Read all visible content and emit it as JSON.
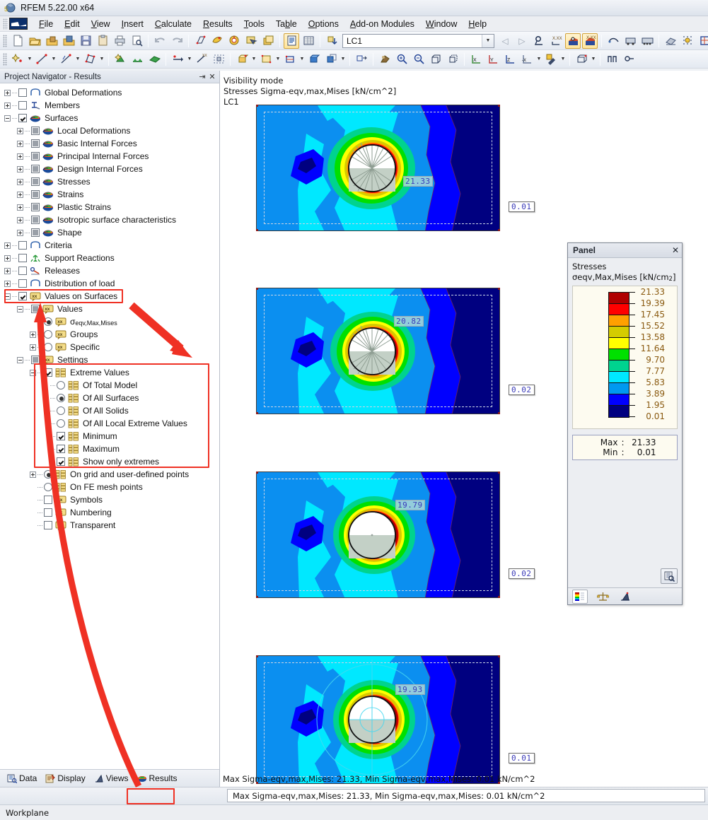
{
  "window": {
    "title": "RFEM 5.22.00 x64",
    "app_icon": "rfem-logo-icon"
  },
  "menu": {
    "items": [
      {
        "label": "File",
        "mnemonic": "F"
      },
      {
        "label": "Edit",
        "mnemonic": "E"
      },
      {
        "label": "View",
        "mnemonic": "V"
      },
      {
        "label": "Insert",
        "mnemonic": "I"
      },
      {
        "label": "Calculate",
        "mnemonic": "C"
      },
      {
        "label": "Results",
        "mnemonic": "R"
      },
      {
        "label": "Tools",
        "mnemonic": "T"
      },
      {
        "label": "Table",
        "mnemonic": "b"
      },
      {
        "label": "Options",
        "mnemonic": "O"
      },
      {
        "label": "Add-on Modules",
        "mnemonic": "A"
      },
      {
        "label": "Window",
        "mnemonic": "W"
      },
      {
        "label": "Help",
        "mnemonic": "H"
      }
    ]
  },
  "toolbar": {
    "load_case_value": "LC1",
    "load_case_placeholder": "LC1"
  },
  "navigator": {
    "title": "Project Navigator - Results",
    "pin_icon": "pin-icon",
    "close_icon": "close-icon",
    "tree": [
      {
        "label": "Global Deformations",
        "indent": 0,
        "expander": "plus",
        "control": "checkbox",
        "state": "unchecked",
        "icon": "deformation-icon"
      },
      {
        "label": "Members",
        "indent": 0,
        "expander": "plus",
        "control": "checkbox",
        "state": "unchecked",
        "icon": "member-icon"
      },
      {
        "label": "Surfaces",
        "indent": 0,
        "expander": "minus",
        "control": "checkbox",
        "state": "checked",
        "icon": "surface-icon"
      },
      {
        "label": "Local Deformations",
        "indent": 1,
        "expander": "plus",
        "control": "checkbox",
        "state": "grey",
        "icon": "surface-icon"
      },
      {
        "label": "Basic Internal Forces",
        "indent": 1,
        "expander": "plus",
        "control": "checkbox",
        "state": "grey",
        "icon": "surface-icon"
      },
      {
        "label": "Principal Internal Forces",
        "indent": 1,
        "expander": "plus",
        "control": "checkbox",
        "state": "grey",
        "icon": "surface-icon"
      },
      {
        "label": "Design Internal Forces",
        "indent": 1,
        "expander": "plus",
        "control": "checkbox",
        "state": "grey",
        "icon": "surface-icon"
      },
      {
        "label": "Stresses",
        "indent": 1,
        "expander": "plus",
        "control": "checkbox",
        "state": "grey",
        "icon": "surface-icon"
      },
      {
        "label": "Strains",
        "indent": 1,
        "expander": "plus",
        "control": "checkbox",
        "state": "grey",
        "icon": "surface-icon"
      },
      {
        "label": "Plastic Strains",
        "indent": 1,
        "expander": "plus",
        "control": "checkbox",
        "state": "grey",
        "icon": "surface-icon"
      },
      {
        "label": "Isotropic surface characteristics",
        "indent": 1,
        "expander": "plus",
        "control": "checkbox",
        "state": "grey",
        "icon": "surface-icon"
      },
      {
        "label": "Shape",
        "indent": 1,
        "expander": "plus",
        "control": "checkbox",
        "state": "grey",
        "icon": "surface-icon"
      },
      {
        "label": "Criteria",
        "indent": 0,
        "expander": "plus",
        "control": "checkbox",
        "state": "unchecked",
        "icon": "criteria-icon"
      },
      {
        "label": "Support Reactions",
        "indent": 0,
        "expander": "plus",
        "control": "checkbox",
        "state": "unchecked",
        "icon": "support-icon"
      },
      {
        "label": "Releases",
        "indent": 0,
        "expander": "plus",
        "control": "checkbox",
        "state": "unchecked",
        "icon": "release-icon"
      },
      {
        "label": "Distribution of load",
        "indent": 0,
        "expander": "plus",
        "control": "checkbox",
        "state": "unchecked",
        "icon": "load-icon"
      },
      {
        "label": "Values on Surfaces",
        "indent": 0,
        "expander": "minus",
        "control": "checkbox",
        "state": "checked",
        "icon": "xx-icon",
        "highlight": true
      },
      {
        "label": "Values",
        "indent": 1,
        "expander": "minus",
        "control": "checkbox",
        "state": "grey",
        "icon": "xx-icon"
      },
      {
        "label": "σeqv,Max,Mises",
        "indent": 2,
        "expander": "none",
        "control": "radio",
        "state": "selected",
        "icon": "xx-icon"
      },
      {
        "label": "Groups",
        "indent": 2,
        "expander": "plus",
        "control": "radio",
        "state": "unselected",
        "icon": "xx-icon"
      },
      {
        "label": "Specific",
        "indent": 2,
        "expander": "plus",
        "control": "radio",
        "state": "unselected",
        "icon": "xx-icon"
      },
      {
        "label": "Settings",
        "indent": 1,
        "expander": "minus",
        "control": "checkbox",
        "state": "grey",
        "icon": "xx-icon"
      },
      {
        "label": "Extreme Values",
        "indent": 2,
        "expander": "minus",
        "control": "checkbox",
        "state": "checked",
        "icon": "grid-icon"
      },
      {
        "label": "Of Total Model",
        "indent": 3,
        "expander": "none",
        "control": "radio",
        "state": "unselected",
        "icon": "grid-icon"
      },
      {
        "label": "Of All Surfaces",
        "indent": 3,
        "expander": "none",
        "control": "radio",
        "state": "selected",
        "icon": "grid-icon"
      },
      {
        "label": "Of All Solids",
        "indent": 3,
        "expander": "none",
        "control": "radio",
        "state": "unselected",
        "icon": "grid-icon"
      },
      {
        "label": "Of All Local Extreme Values",
        "indent": 3,
        "expander": "none",
        "control": "radio",
        "state": "unselected",
        "icon": "grid-icon"
      },
      {
        "label": "Minimum",
        "indent": 3,
        "expander": "none",
        "control": "checkbox",
        "state": "checked",
        "icon": "grid-icon"
      },
      {
        "label": "Maximum",
        "indent": 3,
        "expander": "none",
        "control": "checkbox",
        "state": "checked",
        "icon": "grid-icon"
      },
      {
        "label": "Show only extremes",
        "indent": 3,
        "expander": "none",
        "control": "checkbox",
        "state": "checked",
        "icon": "grid-icon"
      },
      {
        "label": "On grid and user-defined points",
        "indent": 2,
        "expander": "plus",
        "control": "radio",
        "state": "selected",
        "icon": "grid-icon"
      },
      {
        "label": "On FE mesh points",
        "indent": 2,
        "expander": "none",
        "control": "radio",
        "state": "unselected",
        "icon": "grid-icon"
      },
      {
        "label": "Symbols",
        "indent": 2,
        "expander": "none",
        "control": "checkbox",
        "state": "unchecked",
        "icon": "xx-icon"
      },
      {
        "label": "Numbering",
        "indent": 2,
        "expander": "none",
        "control": "checkbox",
        "state": "unchecked",
        "icon": "xx-icon"
      },
      {
        "label": "Transparent",
        "indent": 2,
        "expander": "none",
        "control": "checkbox",
        "state": "unchecked",
        "icon": "xx-icon"
      }
    ],
    "tabs": [
      {
        "label": "Data",
        "icon": "data-icon",
        "active": false
      },
      {
        "label": "Display",
        "icon": "display-icon",
        "active": false
      },
      {
        "label": "Views",
        "icon": "views-icon",
        "active": false
      },
      {
        "label": "Results",
        "icon": "results-icon",
        "active": true,
        "highlight": true
      }
    ]
  },
  "workarea": {
    "visibility_mode": "Visibility mode",
    "result_type": "Stresses Sigma-eqv,max,Mises [kN/cm^2]",
    "load_case": "LC1",
    "summary": "Max Sigma-eqv,max,Mises: 21.33, Min Sigma-eqv,max,Mises: 0.01 kN/cm^2",
    "plots": [
      {
        "max_label": "21.33",
        "min_label": "0.01",
        "hole_style": "hatched-rays"
      },
      {
        "max_label": "20.82",
        "min_label": "0.02",
        "hole_style": "hatched-rays"
      },
      {
        "max_label": "19.79",
        "min_label": "0.02",
        "hole_style": "plain"
      },
      {
        "max_label": "19.93",
        "min_label": "0.01",
        "hole_style": "circles"
      }
    ]
  },
  "panel": {
    "header": "Panel",
    "close_icon": "close-icon",
    "title": "Stresses",
    "quantity": "σeqv,Max,Mises",
    "unit": "[kN/cm",
    "unit_exp": "2",
    "unit_close": "]",
    "max_key": "Max",
    "max_colon": ":",
    "max_value": "21.33",
    "min_key": "Min",
    "min_colon": ":",
    "min_value": "0.01",
    "zoom_icon": "legend-detail-icon",
    "tabs": [
      {
        "icon": "color-scale-icon",
        "active": true
      },
      {
        "icon": "scale-factor-icon",
        "active": false
      },
      {
        "icon": "display-factor-icon",
        "active": false
      }
    ],
    "legend": {
      "values": [
        "21.33",
        "19.39",
        "17.45",
        "15.52",
        "13.58",
        "11.64",
        "9.70",
        "7.77",
        "5.83",
        "3.89",
        "1.95",
        "0.01"
      ],
      "colors": [
        "#b00000",
        "#ff0000",
        "#ffa000",
        "#d4cc00",
        "#ffff00",
        "#00e000",
        "#00d38f",
        "#00e8ff",
        "#0099f0",
        "#0000ff",
        "#000080"
      ]
    }
  },
  "statusbar": {
    "message": "Max Sigma-eqv,max,Mises: 21.33, Min Sigma-eqv,max,Mises: 0.01 kN/cm^2",
    "workplane": "Workplane"
  },
  "chart_data": {
    "type": "heatmap",
    "title": "Stresses Sigma-eqv,max,Mises [kN/cm^2]",
    "subtitle": "LC1",
    "colorbar_label": "σeqv,Max,Mises [kN/cm2]",
    "legend_position": "right-panel",
    "ticks": [
      21.33,
      19.39,
      17.45,
      15.52,
      13.58,
      11.64,
      9.7,
      7.77,
      5.83,
      3.89,
      1.95,
      0.01
    ],
    "band_colors": [
      "#b00000",
      "#ff0000",
      "#ffa000",
      "#d4cc00",
      "#ffff00",
      "#00e000",
      "#00d38f",
      "#00e8ff",
      "#0099f0",
      "#0000ff",
      "#000080"
    ],
    "zlim": [
      0.01,
      21.33
    ],
    "global_max": 21.33,
    "global_min": 0.01,
    "panels": [
      {
        "index": 1,
        "max": 21.33,
        "min": 0.01
      },
      {
        "index": 2,
        "max": 20.82,
        "min": 0.02
      },
      {
        "index": 3,
        "max": 19.79,
        "min": 0.02
      },
      {
        "index": 4,
        "max": 19.93,
        "min": 0.01
      }
    ]
  }
}
